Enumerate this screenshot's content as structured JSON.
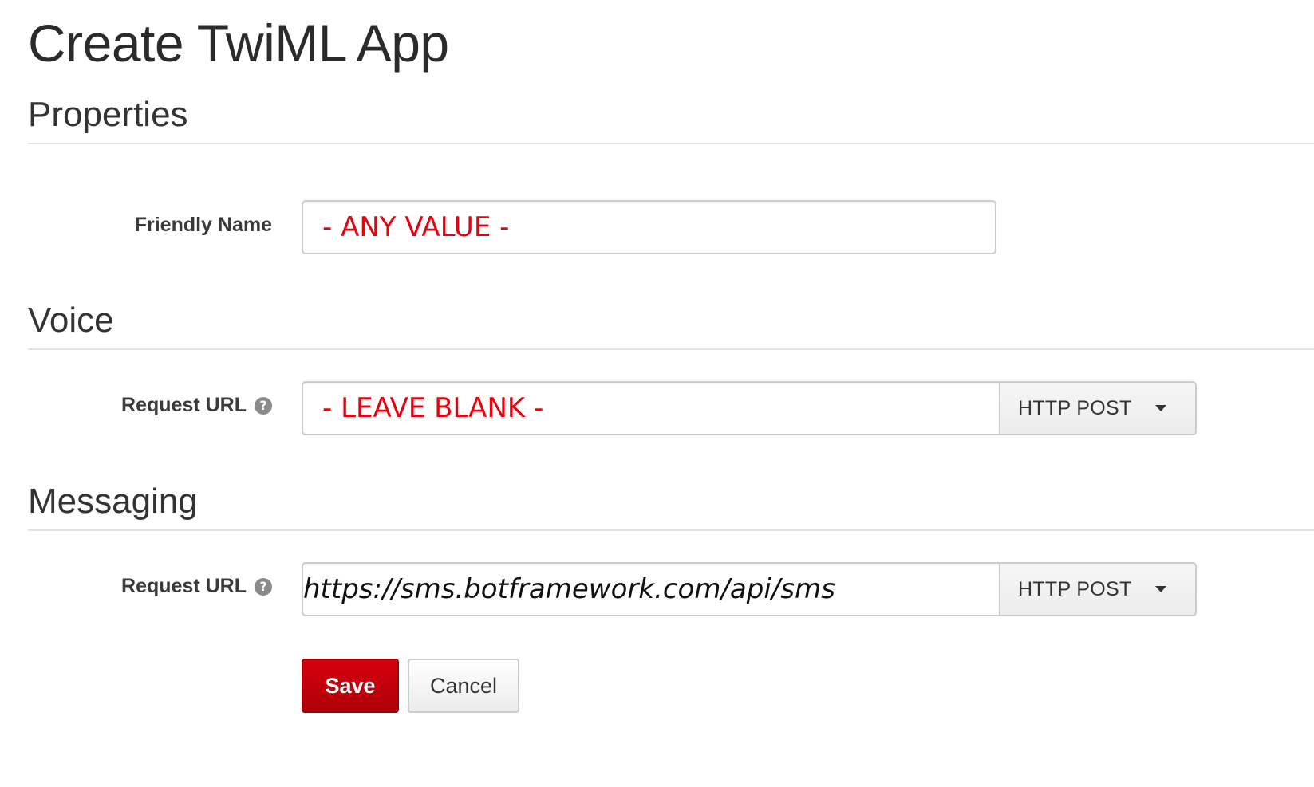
{
  "page": {
    "title": "Create TwiML App"
  },
  "sections": {
    "properties": {
      "heading": "Properties",
      "friendly_name": {
        "label": "Friendly Name",
        "value": "- ANY VALUE -"
      }
    },
    "voice": {
      "heading": "Voice",
      "request_url": {
        "label": "Request URL",
        "help_icon": "question-circle-icon",
        "value": "- LEAVE BLANK -",
        "method": "HTTP POST"
      }
    },
    "messaging": {
      "heading": "Messaging",
      "request_url": {
        "label": "Request URL",
        "help_icon": "question-circle-icon",
        "value": "https://sms.botframework.com/api/sms",
        "method": "HTTP POST"
      }
    }
  },
  "actions": {
    "save_label": "Save",
    "cancel_label": "Cancel"
  },
  "colors": {
    "annotation_red": "#e8000e",
    "save_button": "#c0000c"
  }
}
